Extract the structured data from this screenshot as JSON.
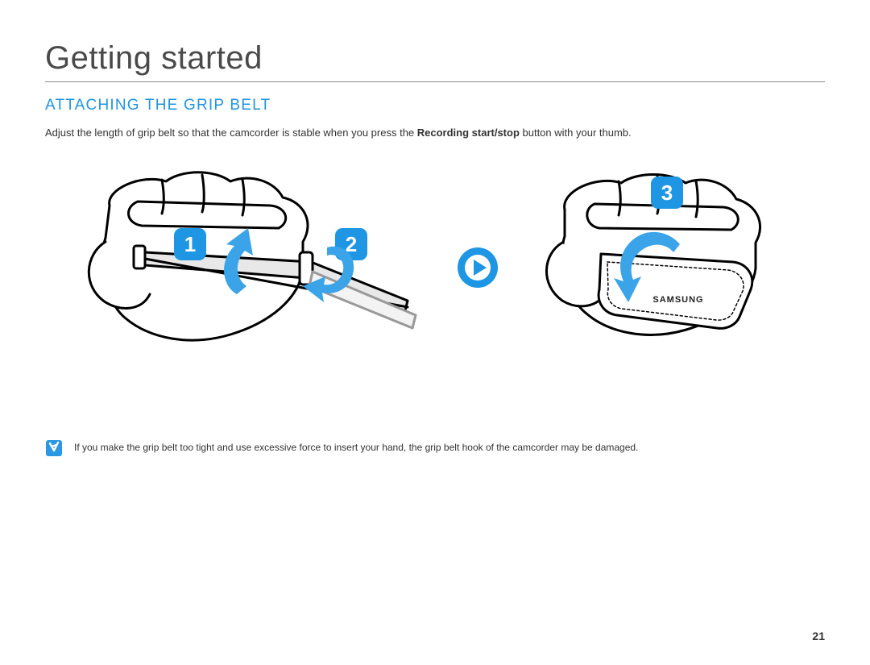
{
  "title": "Getting started",
  "section_heading": "ATTACHING THE GRIP BELT",
  "intro_before_bold": "Adjust the length of grip belt so that the camcorder is stable when you press the ",
  "intro_bold": "Recording start/stop",
  "intro_after_bold": " button with your thumb.",
  "note_text": "If you make the grip belt too tight and use excessive force to insert your hand, the grip belt hook of the camcorder may be damaged.",
  "page_number": "21",
  "badges": {
    "step1": "1",
    "step2": "2",
    "step3": "3"
  },
  "brand_label": "SAMSUNG"
}
